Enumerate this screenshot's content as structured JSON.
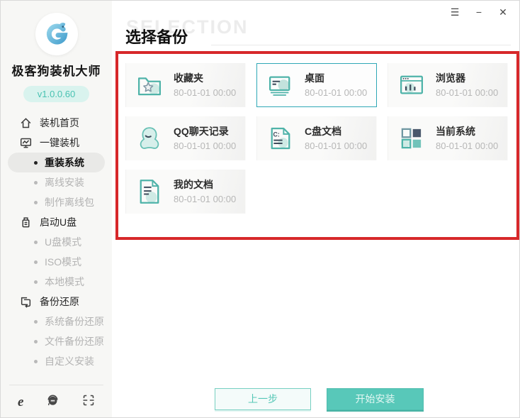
{
  "window": {
    "controls": [
      {
        "name": "menu",
        "glyph": "☰"
      },
      {
        "name": "minimize",
        "glyph": "−"
      },
      {
        "name": "close",
        "glyph": "✕"
      }
    ]
  },
  "sidebar": {
    "app_name": "极客狗装机大师",
    "version": "v1.0.0.60",
    "nav": [
      {
        "label": "装机首页",
        "type": "section",
        "icon": "home-icon"
      },
      {
        "label": "一键装机",
        "type": "section",
        "icon": "monitor-chart-icon"
      },
      {
        "label": "重装系统",
        "type": "sub",
        "state": "active"
      },
      {
        "label": "离线安装",
        "type": "sub"
      },
      {
        "label": "制作离线包",
        "type": "sub"
      },
      {
        "label": "启动U盘",
        "type": "section",
        "icon": "usb-drive-icon"
      },
      {
        "label": "U盘模式",
        "type": "sub"
      },
      {
        "label": "ISO模式",
        "type": "sub"
      },
      {
        "label": "本地模式",
        "type": "sub"
      },
      {
        "label": "备份还原",
        "type": "section",
        "icon": "backup-restore-icon"
      },
      {
        "label": "系统备份还原",
        "type": "sub"
      },
      {
        "label": "文件备份还原",
        "type": "sub"
      },
      {
        "label": "自定义安装",
        "type": "sub"
      }
    ],
    "footer_icons": [
      "ie-browser-icon",
      "support-headset-icon",
      "qr-scan-icon"
    ],
    "ie_glyph": "e"
  },
  "main": {
    "watermark": "SELECTION",
    "title": "选择备份",
    "cards": [
      {
        "title": "收藏夹",
        "date": "80-01-01 00:00",
        "icon": "folder-star-icon",
        "selected": false
      },
      {
        "title": "桌面",
        "date": "80-01-01 00:00",
        "icon": "desktop-icon",
        "selected": true
      },
      {
        "title": "浏览器",
        "date": "80-01-01 00:00",
        "icon": "browser-icon",
        "selected": false
      },
      {
        "title": "QQ聊天记录",
        "date": "80-01-01 00:00",
        "icon": "qq-penguin-icon",
        "selected": false
      },
      {
        "title": "C盘文档",
        "date": "80-01-01 00:00",
        "icon": "c-drive-doc-icon",
        "selected": false
      },
      {
        "title": "当前系统",
        "date": "80-01-01 00:00",
        "icon": "system-tiles-icon",
        "selected": false
      },
      {
        "title": "我的文档",
        "date": "80-01-01 00:00",
        "icon": "my-documents-icon",
        "selected": false
      }
    ],
    "prev_label": "上一步",
    "start_label": "开始安装"
  },
  "annotation": {
    "type": "red-rectangle-highlight"
  },
  "colors": {
    "accent_teal": "#58c8b9",
    "icon_teal": "#4fb3a9",
    "icon_light_teal": "#cfeae5",
    "icon_dark_navy": "#3f4c5c",
    "selected_border": "#2fa8b6",
    "annotation_red": "#d7282a",
    "sidebar_bg": "#f7f7f5",
    "version_pill_bg": "#d9f3ee"
  }
}
